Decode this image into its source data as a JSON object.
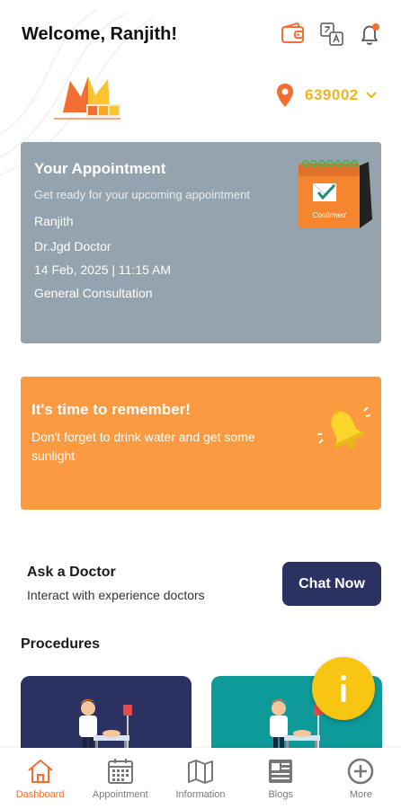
{
  "header": {
    "welcome": "Welcome, Ranjith!",
    "icons": [
      "wallet-icon",
      "translate-icon",
      "bell-icon"
    ],
    "notification_dot": true
  },
  "location": {
    "pincode": "639002",
    "icon": "location-pin-icon"
  },
  "appointment": {
    "title": "Your Appointment",
    "subtitle": "Get ready for your upcoming appointment",
    "patient": "Ranjith",
    "doctor": "Dr.Jgd Doctor",
    "datetime": "14 Feb, 2025 | 11:15 AM",
    "type": "General Consultation",
    "status_label": "Confirmed"
  },
  "reminder": {
    "title": "It's time to remember!",
    "text": "Don't forget to drink water and get some sunlight"
  },
  "ask_doctor": {
    "title": "Ask a Doctor",
    "subtitle": "Interact with experience doctors",
    "button": "Chat Now"
  },
  "procedures": {
    "title": "Procedures"
  },
  "bottom_nav": {
    "items": [
      {
        "label": "Dashboard",
        "icon": "home-icon",
        "active": true
      },
      {
        "label": "Appointment",
        "icon": "calendar-icon",
        "active": false
      },
      {
        "label": "Information",
        "icon": "map-icon",
        "active": false
      },
      {
        "label": "Blogs",
        "icon": "blog-icon",
        "active": false
      },
      {
        "label": "More",
        "icon": "plus-circle-icon",
        "active": false
      }
    ]
  },
  "colors": {
    "accent": "#f36f31",
    "pincode": "#f2b517",
    "appointment_card": "#95a3ae",
    "reminder_card": "#fb9a40",
    "navy": "#2b3262",
    "teal": "#0f9a9a",
    "fab": "#f8c513"
  }
}
